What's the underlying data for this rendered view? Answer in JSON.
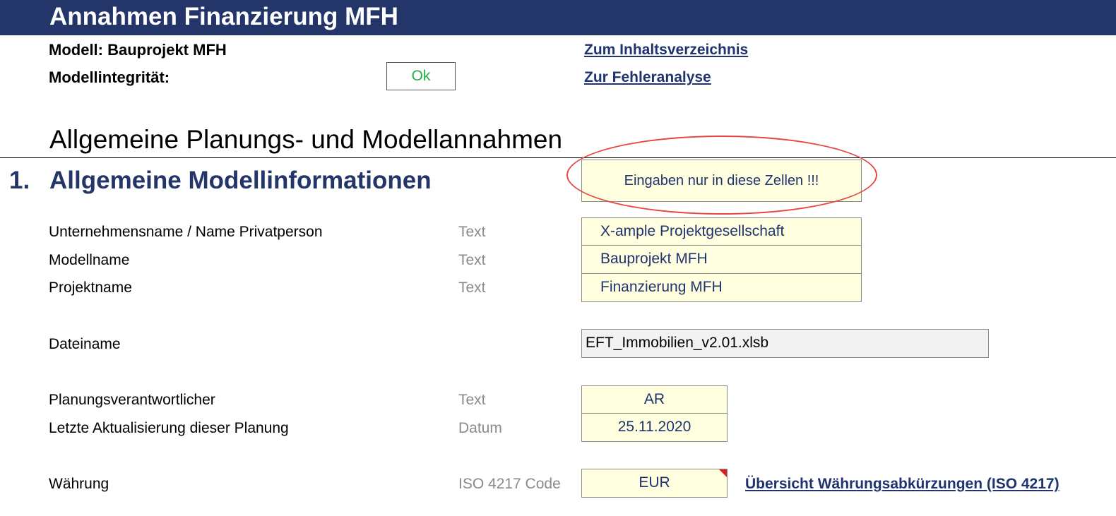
{
  "header": {
    "title": "Annahmen Finanzierung MFH",
    "banner_color": "#243569"
  },
  "model_info": {
    "model_label": "Modell: Bauprojekt MFH",
    "integrity_label": "Modellintegrität:",
    "integrity_status": "Ok",
    "status_color": "#1fae4c"
  },
  "links": {
    "toc": "Zum Inhaltsverzeichnis",
    "error_analysis": "Zur Fehleranalyse",
    "currency_overview": "Übersicht Währungsabkürzungen (ISO 4217)"
  },
  "section": {
    "title": "Allgemeine Planungs- und Modellannahmen"
  },
  "chapter": {
    "number": "1.",
    "title": "Allgemeine Modellinformationen"
  },
  "legend": {
    "text": "Eingaben nur in diese Zellen !!!",
    "input_color": "#ffffe0",
    "highlight_color": "#e84545"
  },
  "rows": {
    "company": {
      "label": "Unternehmensname / Name Privatperson",
      "type": "Text",
      "value": "X-ample Projektgesellschaft"
    },
    "model_name": {
      "label": "Modellname",
      "type": "Text",
      "value": "Bauprojekt MFH"
    },
    "project_name": {
      "label": "Projektname",
      "type": "Text",
      "value": "Finanzierung MFH"
    },
    "file_name": {
      "label": "Dateiname",
      "value": "EFT_Immobilien_v2.01.xlsb"
    },
    "planner": {
      "label": "Planungsverantwortlicher",
      "type": "Text",
      "value": "AR"
    },
    "last_update": {
      "label": "Letzte Aktualisierung dieser Planung",
      "type": "Datum",
      "value": "25.11.2020"
    },
    "currency": {
      "label": "Währung",
      "type": "ISO 4217 Code",
      "value": "EUR"
    }
  }
}
